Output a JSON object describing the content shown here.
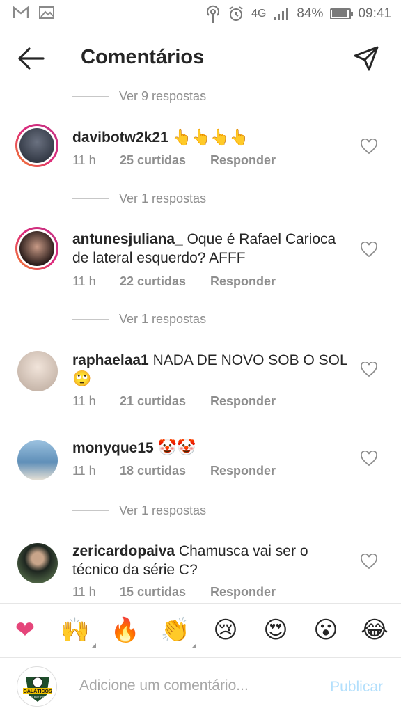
{
  "status_bar": {
    "network": "4G",
    "battery": "84%",
    "battery_level": 0.84,
    "time": "09:41",
    "icons": [
      "gmail-icon",
      "image-icon",
      "hotspot-icon",
      "alarm-icon",
      "signal-icon",
      "battery-icon"
    ]
  },
  "header": {
    "title": "Comentários",
    "back_icon": "arrow-left-icon",
    "send_icon": "paper-plane-icon"
  },
  "replies_links": [
    "Ver 9 respostas",
    "Ver 1 respostas",
    "Ver 1 respostas",
    "Ver 1 respostas"
  ],
  "comments": [
    {
      "username": "davibotw2k21",
      "text": "",
      "emoji": "👆👆👆👆",
      "time": "11 h",
      "likes": "25 curtidas",
      "reply": "Responder",
      "story_ring": true,
      "avatar_color": "#2f3a4a"
    },
    {
      "username": "antunesjuliana_",
      "text": "Oque é Rafael Carioca de lateral esquerdo? AFFF",
      "emoji": "",
      "time": "11 h",
      "likes": "22 curtidas",
      "reply": "Responder",
      "story_ring": true,
      "avatar_color": "#3a2a28"
    },
    {
      "username": "raphaelaa1",
      "text": "NADA DE NOVO SOB O SOL",
      "emoji": "🙄",
      "time": "11 h",
      "likes": "21 curtidas",
      "reply": "Responder",
      "story_ring": false,
      "avatar_color": "#d9cfc6"
    },
    {
      "username": "monyque15",
      "text": "",
      "emoji": "🤡🤡",
      "time": "11 h",
      "likes": "18 curtidas",
      "reply": "Responder",
      "story_ring": false,
      "avatar_color": "#6d93b7"
    },
    {
      "username": "zericardopaiva",
      "text": "Chamusca vai ser o técnico da série C?",
      "emoji": "",
      "time": "11 h",
      "likes": "15 curtidas",
      "reply": "Responder",
      "story_ring": false,
      "avatar_color": "#3b4a3a"
    }
  ],
  "emoji_bar": [
    "❤",
    "🙌",
    "🔥",
    "👏",
    "😢",
    "😍",
    "😮",
    "😂"
  ],
  "composer": {
    "placeholder": "Adicione um comentário...",
    "publish_label": "Publicar",
    "avatar_logo_text": "GALÁTICOS",
    "avatar_logo_subtext": "ONLINE.COM"
  },
  "colors": {
    "text": "#262626",
    "muted": "#8e8e8e",
    "publish_disabled": "#b2dffc",
    "heart": "#e5457a"
  }
}
